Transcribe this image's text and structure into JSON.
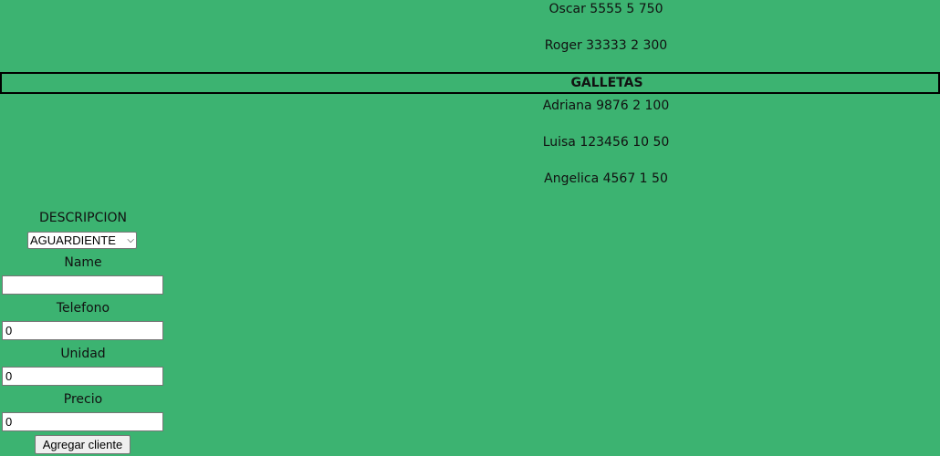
{
  "entries_top": [
    {
      "text": "Oscar 5555 5 750"
    },
    {
      "text": "Roger 33333 2 300"
    }
  ],
  "group": {
    "title": "GALLETAS"
  },
  "entries_group": [
    {
      "text": "Adriana 9876 2 100"
    },
    {
      "text": "Luisa 123456 10 50"
    },
    {
      "text": "Angelica 4567 1 50"
    }
  ],
  "form": {
    "descripcion_label": "DESCRIPCION",
    "descripcion_selected": "AGUARDIENTE",
    "name_label": "Name",
    "name_value": "",
    "telefono_label": "Telefono",
    "telefono_value": "0",
    "unidad_label": "Unidad",
    "unidad_value": "0",
    "precio_label": "Precio",
    "precio_value": "0",
    "submit_label": "Agregar cliente"
  }
}
